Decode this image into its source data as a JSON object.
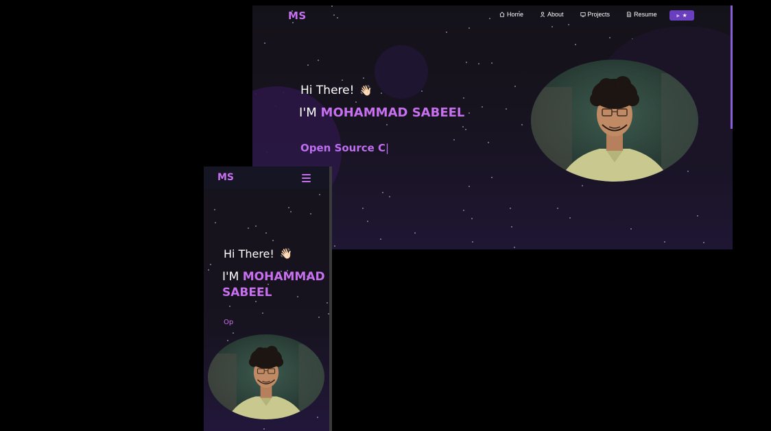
{
  "desktop": {
    "logo": "MS",
    "nav": [
      {
        "label": "Home",
        "icon": "home-icon"
      },
      {
        "label": "About",
        "icon": "user-icon"
      },
      {
        "label": "Projects",
        "icon": "projects-icon"
      },
      {
        "label": "Resume",
        "icon": "document-icon"
      }
    ],
    "theme_toggle": {
      "left": "⫸",
      "right": "★"
    },
    "greeting": "Hi There!",
    "wave": "👋🏻",
    "intro_prefix": "I'M",
    "name": "MOHAMMAD SABEEL",
    "typing_text": "Open Source C",
    "cursor": "|"
  },
  "mobile": {
    "logo": "MS",
    "greeting": "Hi There!",
    "wave": "👋🏻",
    "intro_prefix": "I'M",
    "name_line1": "MOHAMMAD",
    "name_line2": "SABEEL",
    "typing_text": "Op"
  },
  "colors": {
    "accent": "#c770f0",
    "background": "#17131f",
    "theme_button": "#6a3fbf"
  }
}
